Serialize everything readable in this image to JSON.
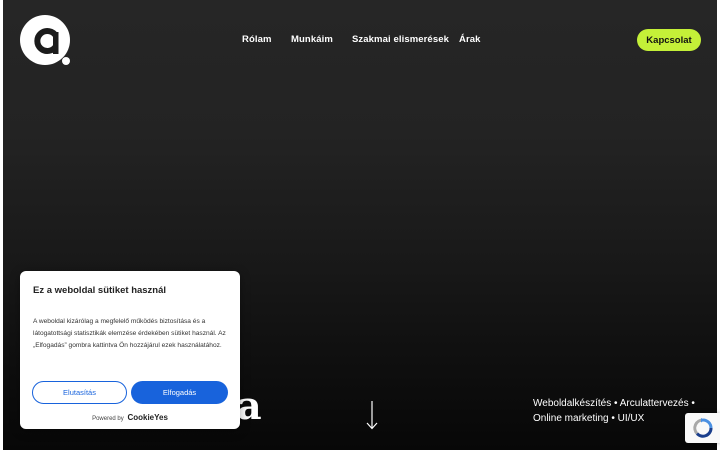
{
  "logo": {
    "icon": "brand-a-logo-icon"
  },
  "nav": {
    "items": [
      "Rólam",
      "Munkáim",
      "Szakmai elismerések",
      "Árak"
    ],
    "cta_label": "Kapcsolat"
  },
  "hero": {
    "partial_heading": "a",
    "services_line1": "Weboldalkészítés • Arculattervezés •",
    "services_line2": "Online marketing • UI/UX",
    "scroll_icon": "arrow-down-icon"
  },
  "cookie_banner": {
    "title": "Ez a weboldal sütiket használ",
    "body": "A weboldal kizárólag a megfelelő működés biztosítása és a látogatottsági statisztikák elemzése érdekében sütiket használ. Az „Elfogadás” gombra kattintva Ön hozzájárul ezek használatához.",
    "reject_label": "Elutasítás",
    "accept_label": "Elfogadás",
    "powered_by": "Powered by",
    "powered_brand": "CookieYes"
  },
  "recaptcha": {
    "icon": "recaptcha-icon"
  },
  "colors": {
    "accent": "#c4f038",
    "primary_button": "#1863dc",
    "background_top": "#262626",
    "background_bottom": "#070707"
  }
}
